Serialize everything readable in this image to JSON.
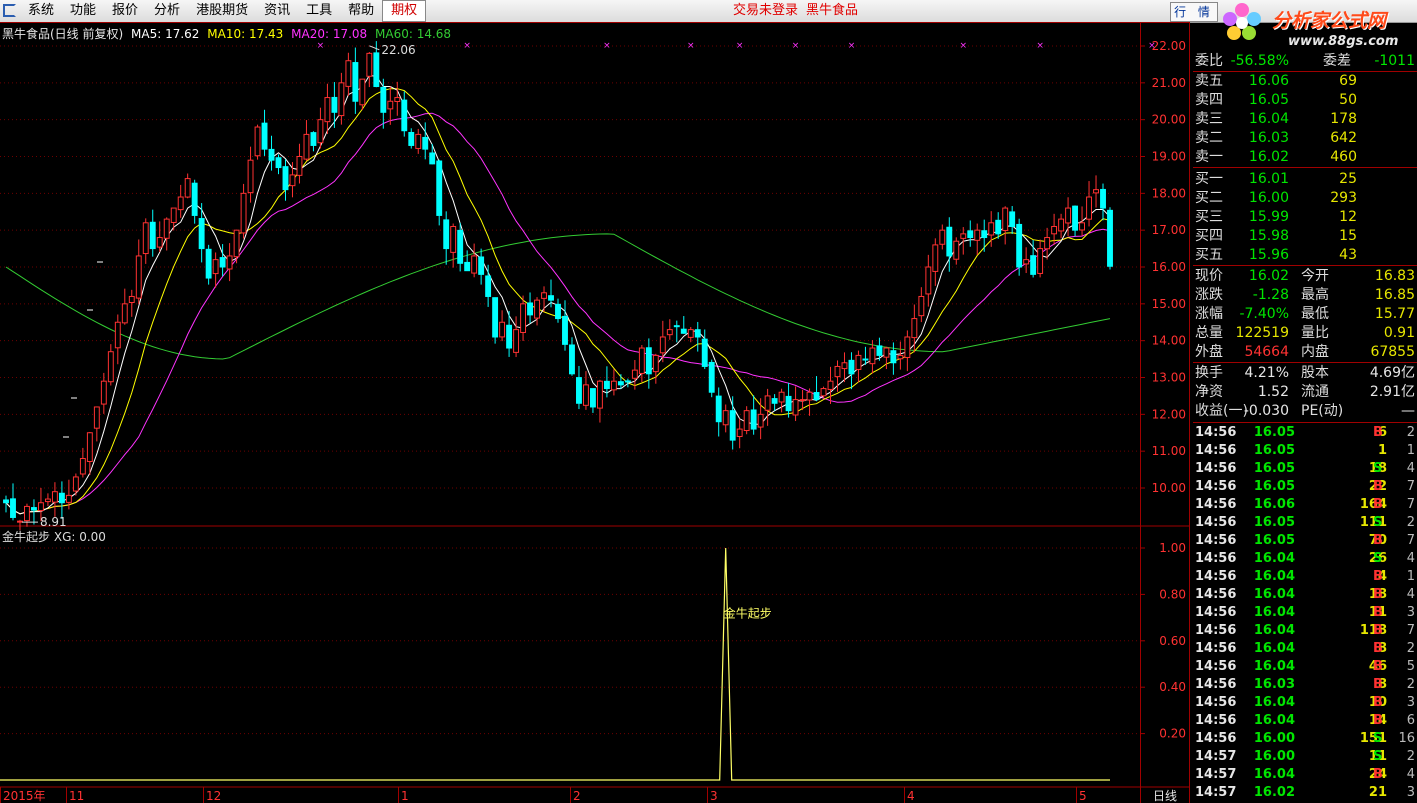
{
  "menu": {
    "items": [
      "系统",
      "功能",
      "报价",
      "分析",
      "港股期货",
      "资讯",
      "工具",
      "帮助",
      "期权"
    ],
    "status": "交易未登录",
    "stock_name": "黑牛食品",
    "quote_button": "行 情"
  },
  "brand": {
    "name": "分析家公式网",
    "url": "www.88gs.com"
  },
  "chart_data": [
    {
      "type": "candlestick",
      "title": "黑牛食品(日线 前复权)",
      "legend": [
        {
          "label": "MA5: 17.62",
          "color": "#ffffff"
        },
        {
          "label": "MA10: 17.43",
          "color": "#ffff00"
        },
        {
          "label": "MA20: 17.08",
          "color": "#ff33ff"
        },
        {
          "label": "MA60: 14.68",
          "color": "#33cc33"
        }
      ],
      "y_ticks": [
        "22.00",
        "21.00",
        "20.00",
        "19.00",
        "18.00",
        "17.00",
        "16.00",
        "15.00",
        "14.00",
        "13.00",
        "12.00",
        "11.00",
        "10.00"
      ],
      "ylim": [
        9.0,
        22.0
      ],
      "high_label": "22.06",
      "low_label": "8.91",
      "x_ticks": [
        "2015年",
        "11",
        "12",
        "1",
        "2",
        "3",
        "4",
        "5"
      ],
      "period": "日线",
      "colors": {
        "up": "#ff3232",
        "down": "#00ffff",
        "ma5": "#ffffff",
        "ma10": "#ffff00",
        "ma20": "#ff33ff",
        "ma60": "#33cc33",
        "marker": "#ff33ff"
      },
      "closes": [
        9.6,
        9.2,
        9.1,
        9.5,
        9.4,
        9.6,
        9.7,
        9.9,
        9.6,
        9.8,
        10.3,
        10.8,
        11.5,
        12.2,
        12.9,
        13.7,
        14.5,
        15.0,
        15.2,
        16.3,
        17.2,
        16.5,
        16.8,
        17.3,
        17.6,
        17.9,
        18.4,
        17.4,
        16.5,
        15.7,
        16.2,
        16.0,
        16.3,
        17.0,
        18.0,
        18.9,
        19.8,
        19.2,
        18.9,
        18.7,
        18.1,
        18.5,
        19.0,
        19.6,
        19.3,
        20.0,
        20.6,
        20.2,
        21.0,
        21.6,
        20.5,
        21.1,
        21.8,
        20.9,
        20.2,
        20.5,
        20.6,
        19.7,
        19.3,
        19.6,
        19.2,
        18.8,
        17.4,
        16.5,
        17.1,
        16.1,
        15.9,
        16.3,
        15.8,
        15.2,
        14.1,
        14.5,
        13.8,
        14.3,
        15.0,
        14.7,
        15.1,
        15.3,
        15.1,
        14.6,
        13.9,
        13.1,
        12.3,
        12.8,
        12.2,
        12.9,
        12.7,
        12.9,
        12.8,
        12.9,
        13.2,
        13.8,
        13.1,
        13.6,
        14.1,
        14.3,
        14.4,
        14.2,
        14.3,
        14.1,
        13.3,
        12.6,
        11.8,
        12.1,
        11.3,
        11.6,
        12.1,
        11.6,
        12.0,
        12.5,
        12.3,
        12.6,
        12.1,
        12.4,
        12.4,
        12.6,
        12.4,
        12.7,
        12.9,
        13.3,
        13.4,
        13.1,
        13.6,
        13.5,
        13.8,
        13.6,
        13.8,
        13.4,
        13.6,
        14.1,
        14.6,
        15.2,
        16.0,
        16.6,
        17.0,
        16.3,
        16.7,
        16.9,
        16.8,
        17.0,
        16.8,
        17.2,
        16.9,
        17.6,
        17.1,
        16.0,
        16.2,
        15.8,
        16.5,
        16.8,
        17.1,
        17.3,
        17.6,
        17.0,
        17.2,
        17.9,
        18.1,
        17.6,
        16.02
      ],
      "markers_x": [
        45,
        66,
        86,
        98,
        105,
        113,
        121,
        137,
        148,
        164,
        170,
        177
      ]
    },
    {
      "type": "line",
      "title": "金牛起步",
      "legend": "XG: 0.00",
      "y_ticks": [
        "1.00",
        "0.80",
        "0.60",
        "0.40",
        "0.20"
      ],
      "ylim": [
        0,
        1.0
      ],
      "signal_label": "金牛起步",
      "signal_index": 103,
      "signal_value": 1.0,
      "color": "#ffff66"
    }
  ],
  "panel": {
    "header": {
      "label": "委比",
      "value": "-56.58%",
      "label2": "委差",
      "value2": "-1011"
    },
    "asks": [
      {
        "label": "卖五",
        "price": "16.06",
        "vol": "69"
      },
      {
        "label": "卖四",
        "price": "16.05",
        "vol": "50"
      },
      {
        "label": "卖三",
        "price": "16.04",
        "vol": "178"
      },
      {
        "label": "卖二",
        "price": "16.03",
        "vol": "642"
      },
      {
        "label": "卖一",
        "price": "16.02",
        "vol": "460"
      }
    ],
    "bids": [
      {
        "label": "买一",
        "price": "16.01",
        "vol": "25"
      },
      {
        "label": "买二",
        "price": "16.00",
        "vol": "293"
      },
      {
        "label": "买三",
        "price": "15.99",
        "vol": "12"
      },
      {
        "label": "买四",
        "price": "15.98",
        "vol": "15"
      },
      {
        "label": "买五",
        "price": "15.96",
        "vol": "43"
      }
    ],
    "stats1": [
      {
        "l1": "现价",
        "v1": "16.02",
        "c1": "green",
        "l2": "今开",
        "v2": "16.83",
        "c2": "yellow"
      },
      {
        "l1": "涨跌",
        "v1": "-1.28",
        "c1": "green",
        "l2": "最高",
        "v2": "16.85",
        "c2": "yellow"
      },
      {
        "l1": "涨幅",
        "v1": "-7.40%",
        "c1": "green",
        "l2": "最低",
        "v2": "15.77",
        "c2": "yellow"
      },
      {
        "l1": "总量",
        "v1": "122519",
        "c1": "yellow",
        "l2": "量比",
        "v2": "0.91",
        "c2": "yellow"
      },
      {
        "l1": "外盘",
        "v1": "54664",
        "c1": "red",
        "l2": "内盘",
        "v2": "67855",
        "c2": "yellow"
      }
    ],
    "stats2": [
      {
        "l1": "换手",
        "v1": "4.21%",
        "c1": "white",
        "l2": "股本",
        "v2": "4.69亿",
        "c2": "white"
      },
      {
        "l1": "净资",
        "v1": "1.52",
        "c1": "white",
        "l2": "流通",
        "v2": "2.91亿",
        "c2": "white"
      },
      {
        "l1": "收益(一)",
        "v1": "-0.030",
        "c1": "white",
        "l2": "PE(动)",
        "v2": "—",
        "c2": "white"
      }
    ],
    "ticks": [
      {
        "time": "14:56",
        "price": "16.05",
        "vol": "6",
        "side": "B",
        "n": "2"
      },
      {
        "time": "14:56",
        "price": "16.05",
        "vol": "1",
        "side": "",
        "n": "1"
      },
      {
        "time": "14:56",
        "price": "16.05",
        "vol": "18",
        "side": "S",
        "n": "4"
      },
      {
        "time": "14:56",
        "price": "16.05",
        "vol": "22",
        "side": "B",
        "n": "7"
      },
      {
        "time": "14:56",
        "price": "16.06",
        "vol": "164",
        "side": "B",
        "n": "7"
      },
      {
        "time": "14:56",
        "price": "16.05",
        "vol": "111",
        "side": "S",
        "n": "2"
      },
      {
        "time": "14:56",
        "price": "16.05",
        "vol": "70",
        "side": "B",
        "n": "7"
      },
      {
        "time": "14:56",
        "price": "16.04",
        "vol": "26",
        "side": "S",
        "n": "4"
      },
      {
        "time": "14:56",
        "price": "16.04",
        "vol": "4",
        "side": "B",
        "n": "1"
      },
      {
        "time": "14:56",
        "price": "16.04",
        "vol": "18",
        "side": "B",
        "n": "4"
      },
      {
        "time": "14:56",
        "price": "16.04",
        "vol": "11",
        "side": "B",
        "n": "3"
      },
      {
        "time": "14:56",
        "price": "16.04",
        "vol": "118",
        "side": "B",
        "n": "7"
      },
      {
        "time": "14:56",
        "price": "16.04",
        "vol": "8",
        "side": "B",
        "n": "2"
      },
      {
        "time": "14:56",
        "price": "16.04",
        "vol": "46",
        "side": "B",
        "n": "5"
      },
      {
        "time": "14:56",
        "price": "16.03",
        "vol": "8",
        "side": "B",
        "n": "2"
      },
      {
        "time": "14:56",
        "price": "16.04",
        "vol": "10",
        "side": "B",
        "n": "3"
      },
      {
        "time": "14:56",
        "price": "16.04",
        "vol": "14",
        "side": "B",
        "n": "6"
      },
      {
        "time": "14:56",
        "price": "16.00",
        "vol": "151",
        "side": "S",
        "n": "16"
      },
      {
        "time": "14:57",
        "price": "16.00",
        "vol": "11",
        "side": "S",
        "n": "2"
      },
      {
        "time": "14:57",
        "price": "16.04",
        "vol": "24",
        "side": "B",
        "n": "4"
      },
      {
        "time": "14:57",
        "price": "16.02",
        "vol": "21",
        "side": "",
        "n": "3"
      }
    ]
  }
}
